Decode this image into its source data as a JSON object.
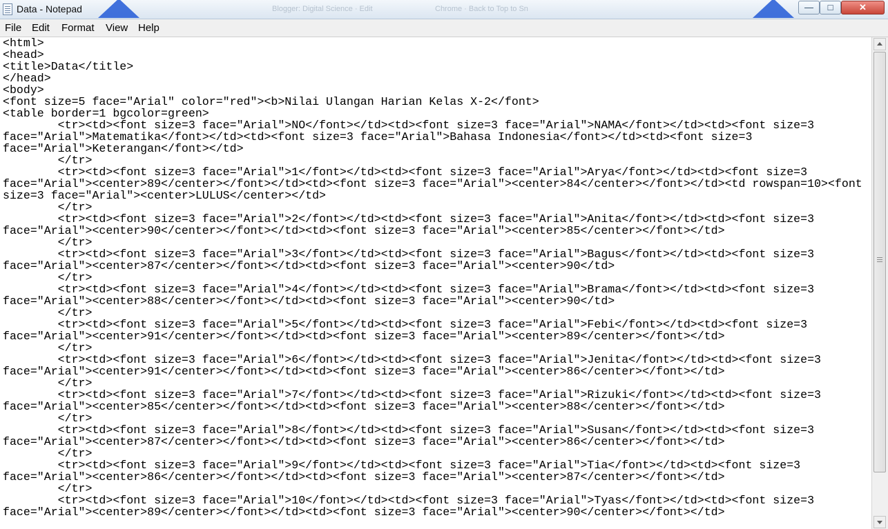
{
  "window": {
    "title": "Data - Notepad",
    "background_items": [
      "Blogger: Digital Science · Edit",
      "Chrome · Back to Top to Sn"
    ]
  },
  "controls": {
    "minimize": "—",
    "maximize": "□",
    "close": "✕"
  },
  "menu": {
    "file": "File",
    "edit": "Edit",
    "format": "Format",
    "view": "View",
    "help": "Help"
  },
  "editor": {
    "content": "<html>\n<head>\n<title>Data</title>\n</head>\n<body>\n<font size=5 face=\"Arial\" color=\"red\"><b>Nilai Ulangan Harian Kelas X-2</font>\n<table border=1 bgcolor=green>\n        <tr><td><font size=3 face=\"Arial\">NO</font></td><td><font size=3 face=\"Arial\">NAMA</font></td><td><font size=3\nface=\"Arial\">Matematika</font></td><td><font size=3 face=\"Arial\">Bahasa Indonesia</font></td><td><font size=3\nface=\"Arial\">Keterangan</font></td>\n        </tr>\n        <tr><td><font size=3 face=\"Arial\">1</font></td><td><font size=3 face=\"Arial\">Arya</font></td><td><font size=3\nface=\"Arial\"><center>89</center></font></td><td><font size=3 face=\"Arial\"><center>84</center></font></td><td rowspan=10><font\nsize=3 face=\"Arial\"><center>LULUS</center></td>\n        </tr>\n        <tr><td><font size=3 face=\"Arial\">2</font></td><td><font size=3 face=\"Arial\">Anita</font></td><td><font size=3\nface=\"Arial\"><center>90</center></font></td><td><font size=3 face=\"Arial\"><center>85</center></font></td>\n        </tr>\n        <tr><td><font size=3 face=\"Arial\">3</font></td><td><font size=3 face=\"Arial\">Bagus</font></td><td><font size=3\nface=\"Arial\"><center>87</center></font></td><td><font size=3 face=\"Arial\"><center>90</td>\n        </tr>\n        <tr><td><font size=3 face=\"Arial\">4</font></td><td><font size=3 face=\"Arial\">Brama</font></td><td><font size=3\nface=\"Arial\"><center>88</center></font></td><td><font size=3 face=\"Arial\"><center>90</td>\n        </tr>\n        <tr><td><font size=3 face=\"Arial\">5</font></td><td><font size=3 face=\"Arial\">Febi</font></td><td><font size=3\nface=\"Arial\"><center>91</center></font></td><td><font size=3 face=\"Arial\"><center>89</center></font></td>\n        </tr>\n        <tr><td><font size=3 face=\"Arial\">6</font></td><td><font size=3 face=\"Arial\">Jenita</font></td><td><font size=3\nface=\"Arial\"><center>91</center></font></td><td><font size=3 face=\"Arial\"><center>86</center></font></td>\n        </tr>\n        <tr><td><font size=3 face=\"Arial\">7</font></td><td><font size=3 face=\"Arial\">Rizuki</font></td><td><font size=3\nface=\"Arial\"><center>85</center></font></td><td><font size=3 face=\"Arial\"><center>88</center></font></td>\n        </tr>\n        <tr><td><font size=3 face=\"Arial\">8</font></td><td><font size=3 face=\"Arial\">Susan</font></td><td><font size=3\nface=\"Arial\"><center>87</center></font></td><td><font size=3 face=\"Arial\"><center>86</center></font></td>\n        </tr>\n        <tr><td><font size=3 face=\"Arial\">9</font></td><td><font size=3 face=\"Arial\">Tia</font></td><td><font size=3\nface=\"Arial\"><center>86</center></font></td><td><font size=3 face=\"Arial\"><center>87</center></font></td>\n        </tr>\n        <tr><td><font size=3 face=\"Arial\">10</font></td><td><font size=3 face=\"Arial\">Tyas</font></td><td><font size=3\nface=\"Arial\"><center>89</center></font></td><td><font size=3 face=\"Arial\"><center>90</center></font></td>"
  },
  "colors": {
    "titlebar": "#dbe6f1",
    "menubar": "#f0f0f0",
    "close_button": "#c9473a"
  }
}
